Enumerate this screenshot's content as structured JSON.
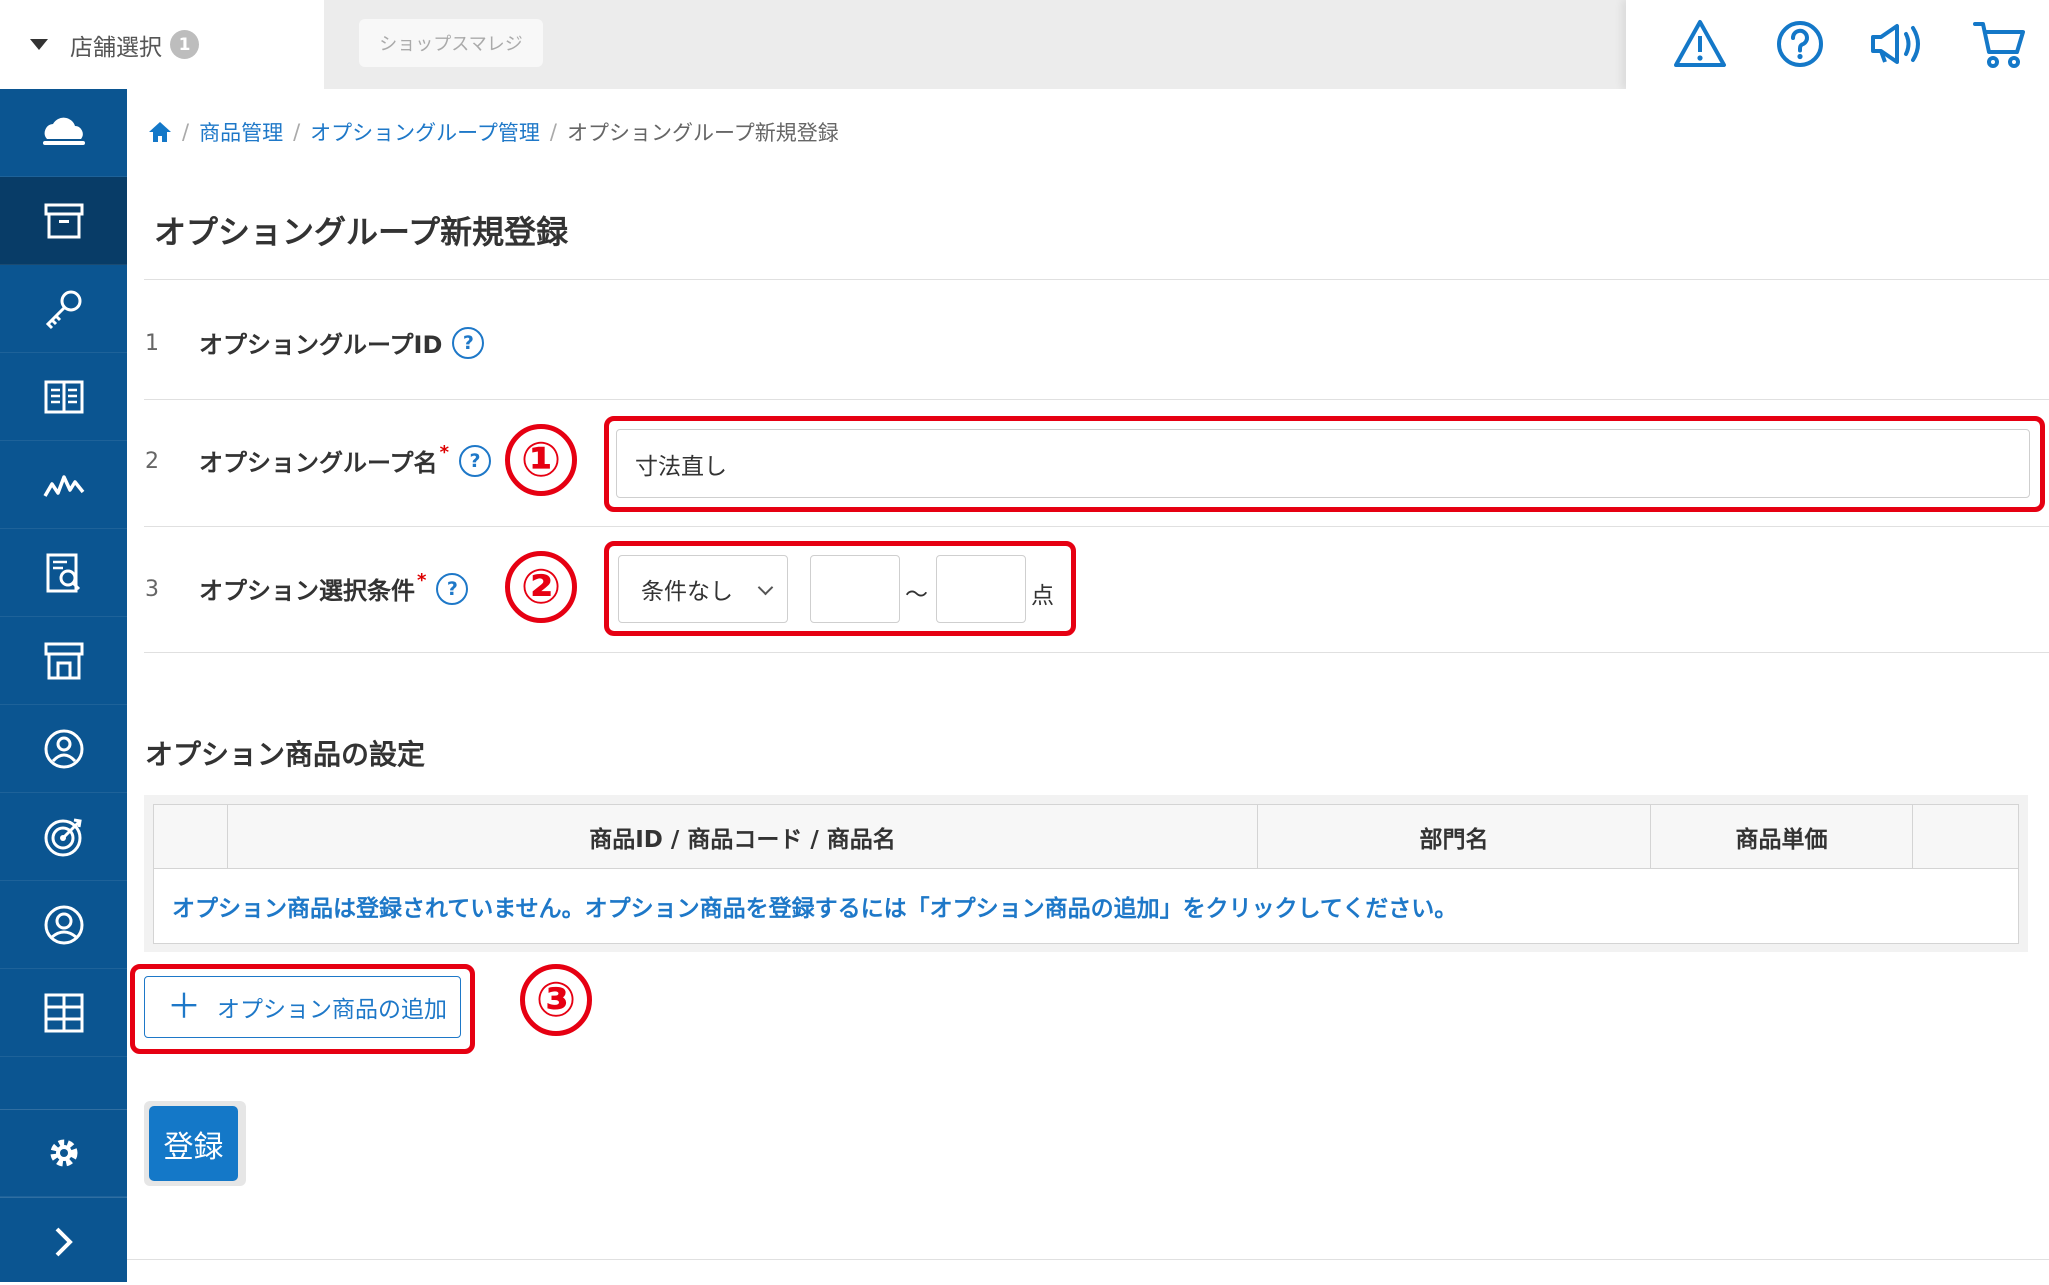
{
  "header": {
    "store_select_label": "店舗選択",
    "store_count": "1",
    "shop_name": "ショップスマレジ",
    "icons": [
      "warning-icon",
      "help-icon",
      "announcement-icon",
      "cart-icon"
    ]
  },
  "sidebar": {
    "items": [
      "cloud-icon",
      "product-box-icon",
      "key-icon",
      "book-icon",
      "chart-icon",
      "report-icon",
      "store-icon",
      "customer-icon",
      "target-icon",
      "member-icon",
      "apps-icon"
    ],
    "bottom": [
      "settings-icon",
      "expand-icon"
    ]
  },
  "breadcrumb": {
    "home_icon": "home-icon",
    "items": [
      "商品管理",
      "オプショングループ管理"
    ],
    "current": "オプショングループ新規登録"
  },
  "page": {
    "title": "オプショングループ新規登録"
  },
  "form": {
    "rows": [
      {
        "num": "1",
        "label": "オプショングループID"
      },
      {
        "num": "2",
        "label": "オプショングループ名",
        "value": "寸法直し"
      },
      {
        "num": "3",
        "label": "オプション選択条件",
        "select_value": "条件なし",
        "range_sep": "〜",
        "unit": "点"
      }
    ],
    "required_mark": "*",
    "help_mark": "?"
  },
  "annotations": [
    "①",
    "②",
    "③"
  ],
  "options_section": {
    "title": "オプション商品の設定",
    "columns": [
      "商品ID / 商品コード / 商品名",
      "部門名",
      "商品単価"
    ],
    "empty_message": "オプション商品は登録されていません。オプション商品を登録するには「オプション商品の追加」をクリックしてください。",
    "add_button": "オプション商品の追加",
    "add_icon": "＋"
  },
  "submit_label": "登録",
  "colors": {
    "accent": "#1e78c8",
    "sidebar": "#0b5591",
    "annotation": "#e60012"
  }
}
